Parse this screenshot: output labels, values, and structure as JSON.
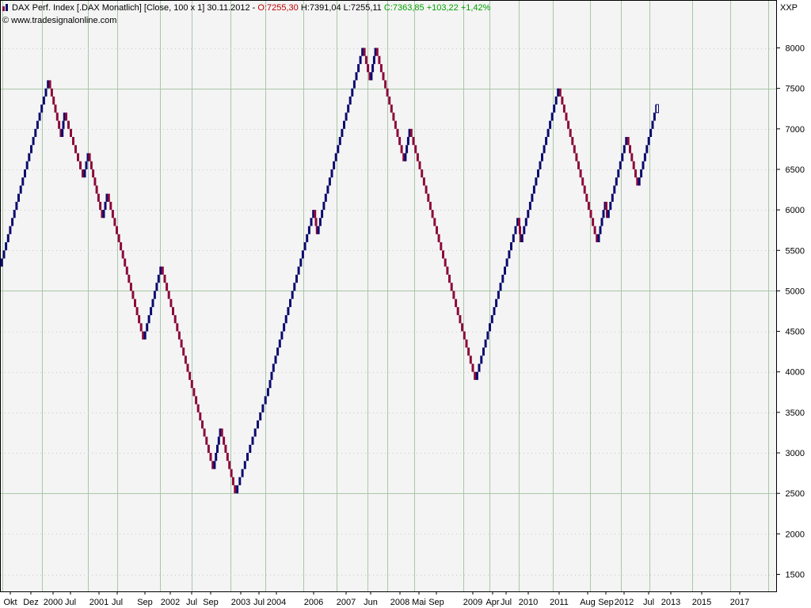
{
  "header": {
    "title": "DAX Perf. Index [.DAX Monatlich] [Close, 100 x 1] 30.11.2012 -",
    "open": "O:7255,30",
    "hl": "H:7391,04 L:7255,11",
    "close": "C:7363,85 +103,22 +1,42%"
  },
  "copyright": "© www.tradesignalonline.com",
  "unit": "XXP",
  "colors": {
    "background": "#f4f4f4",
    "up": "#0a0a6e",
    "down": "#8b0a3a",
    "grid_major": "#a9c7a9",
    "grid_minor": "#c8c8c8",
    "frame": "#000000"
  },
  "chart_data": {
    "type": "line",
    "style": "renko-brick-steps",
    "brick_size": 100,
    "reversal": 1,
    "x_labels": [
      "Okt",
      "Dez",
      "2000",
      "Jul",
      "2001",
      "Jul",
      "Sep",
      "2002",
      "Jul",
      "Sep",
      "2003",
      "Jul",
      "2004",
      "2006",
      "2007",
      "Jun",
      "2008",
      "Mai",
      "Sep",
      "2009",
      "Apr",
      "Jul",
      "2010",
      "2011",
      "Aug",
      "Sep",
      "2012",
      "Jul",
      "2013",
      "2015",
      "2017"
    ],
    "y_ticks": [
      1500,
      2000,
      2500,
      3000,
      3500,
      4000,
      4500,
      5000,
      5500,
      6000,
      6500,
      7000,
      7500,
      8000
    ],
    "ylim": [
      1250,
      8550
    ],
    "grid": true,
    "series": [
      {
        "points": [
          [
            1,
            5300
          ],
          [
            62,
            7600
          ],
          [
            78,
            6900
          ],
          [
            82,
            7200
          ],
          [
            106,
            6400
          ],
          [
            112,
            6700
          ],
          [
            130,
            5900
          ],
          [
            136,
            6200
          ],
          [
            182,
            4400
          ],
          [
            204,
            5300
          ],
          [
            270,
            2800
          ],
          [
            279,
            3300
          ],
          [
            298,
            2500
          ],
          [
            340,
            3800
          ],
          [
            344,
            4000
          ],
          [
            397,
            6000
          ],
          [
            401,
            5700
          ],
          [
            410,
            6100
          ],
          [
            459,
            8000
          ],
          [
            468,
            7600
          ],
          [
            475,
            8000
          ],
          [
            511,
            6600
          ],
          [
            518,
            7000
          ],
          [
            601,
            3900
          ],
          [
            655,
            5900
          ],
          [
            658,
            5600
          ],
          [
            706,
            7500
          ],
          [
            755,
            5600
          ],
          [
            765,
            6100
          ],
          [
            767,
            5900
          ],
          [
            792,
            6900
          ],
          [
            806,
            6300
          ],
          [
            830,
            7300
          ]
        ]
      }
    ]
  }
}
